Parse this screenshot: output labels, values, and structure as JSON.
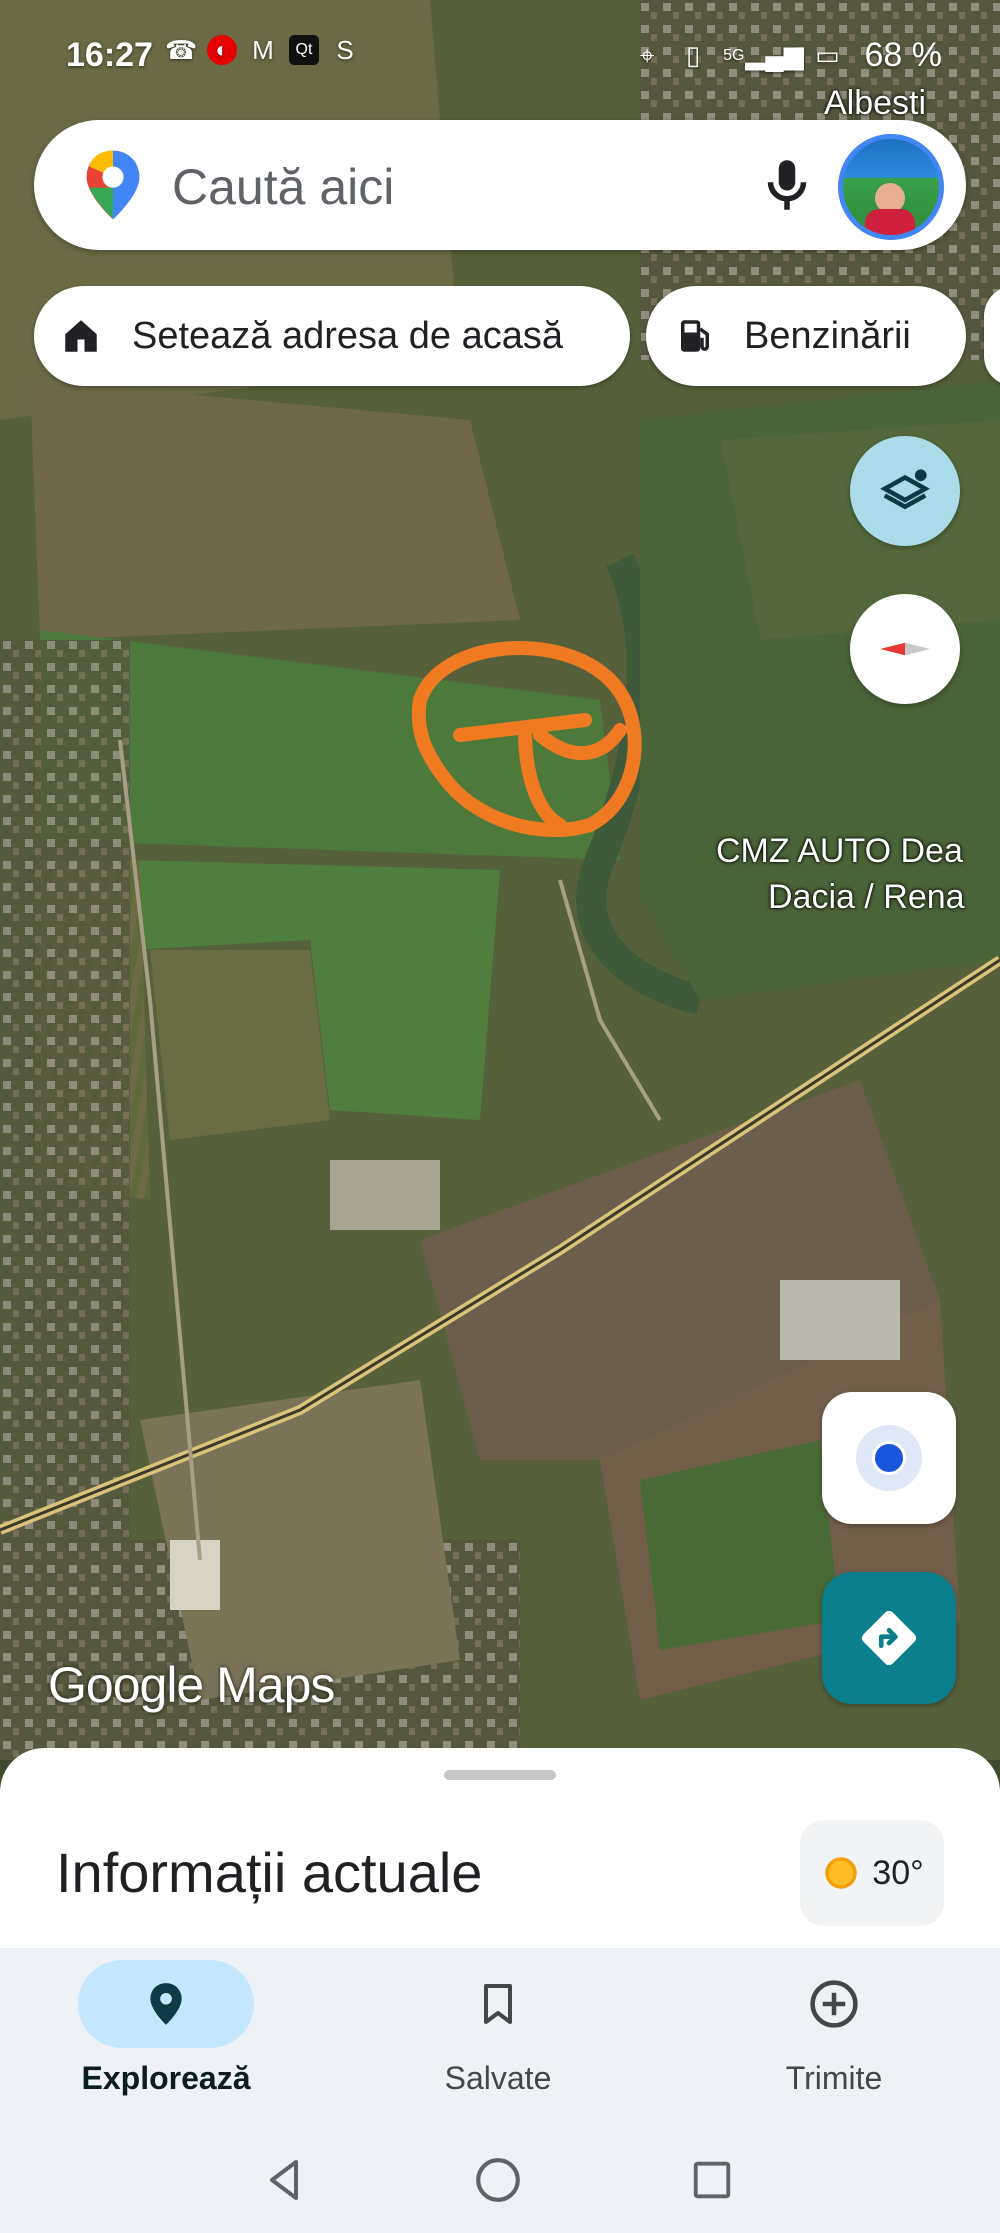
{
  "status_bar": {
    "time": "16:27",
    "battery": "68 %",
    "network": "5G"
  },
  "map": {
    "labels": {
      "albesti": "Albesti",
      "poi_line1": "CMZ AUTO Dea",
      "poi_line2": "Dacia / Rena"
    },
    "logo": "Google Maps"
  },
  "search": {
    "placeholder": "Caută aici"
  },
  "chips": {
    "home": "Setează adresa de acasă",
    "gas": "Benzinării"
  },
  "sheet": {
    "title": "Informații actuale",
    "temperature": "30°"
  },
  "bottom_nav": {
    "explore": "Explorează",
    "saved": "Salvate",
    "contribute": "Trimite"
  },
  "colors": {
    "accent_teal": "#0b7f8c",
    "annotation_orange": "#f07a22",
    "pill_active": "#c2e7ff"
  }
}
